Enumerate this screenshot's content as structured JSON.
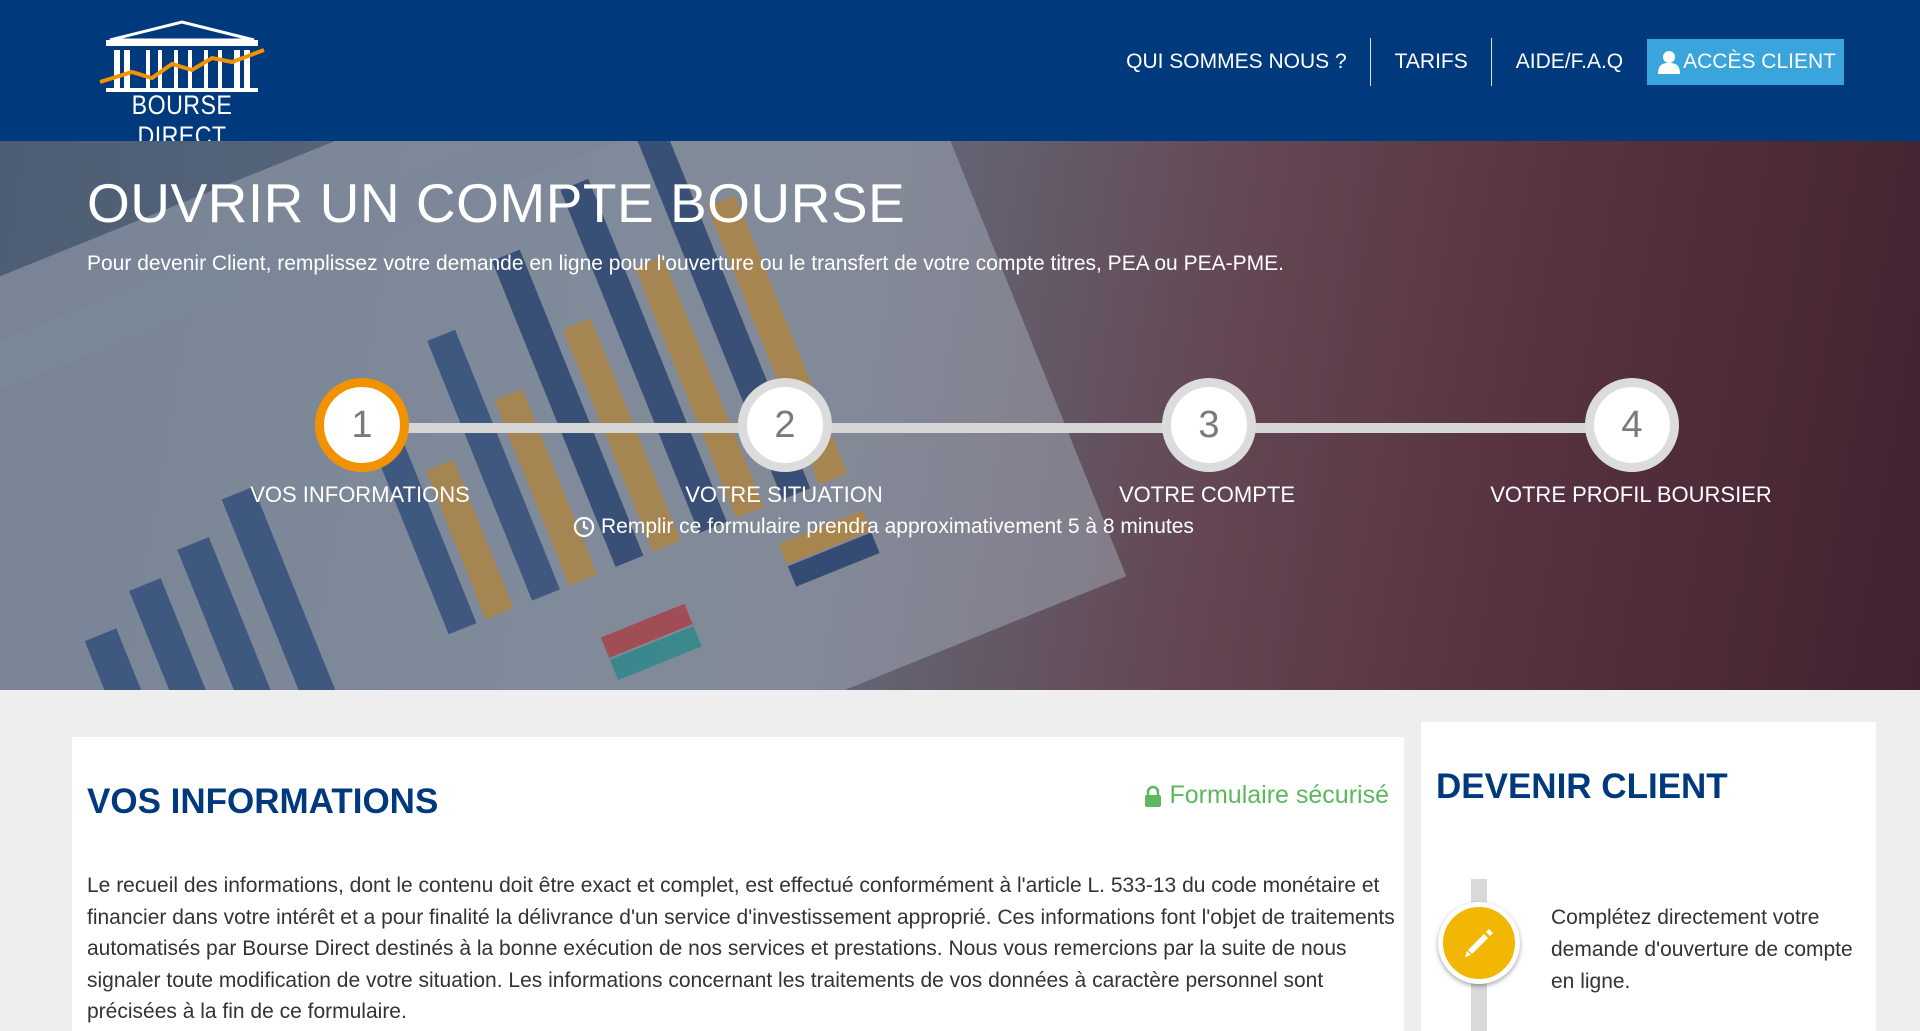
{
  "header": {
    "logo_text": "BOURSE DIRECT",
    "nav": [
      {
        "label": "QUI SOMMES NOUS ?"
      },
      {
        "label": "TARIFS"
      },
      {
        "label": "AIDE/F.A.Q"
      }
    ],
    "client_button": "ACCÈS CLIENT",
    "colors": {
      "header_bg": "#003a7d",
      "client_button_bg": "#3aa4dc"
    }
  },
  "hero": {
    "title": "OUVRIR UN COMPTE BOURSE",
    "subtitle": "Pour devenir Client, remplissez votre demande en ligne pour l'ouverture ou le transfert de votre compte titres, PEA ou PEA-PME.",
    "steps": [
      {
        "number": "1",
        "label": "VOS INFORMATIONS",
        "active": true
      },
      {
        "number": "2",
        "label": "VOTRE SITUATION",
        "active": false
      },
      {
        "number": "3",
        "label": "VOTRE COMPTE",
        "active": false
      },
      {
        "number": "4",
        "label": "VOTRE PROFIL BOURSIER",
        "active": false
      }
    ],
    "duration_text": "Remplir ce formulaire prendra approximativement 5 à 8 minutes",
    "colors": {
      "active_step": "#f39200"
    }
  },
  "form_card": {
    "title": "VOS INFORMATIONS",
    "secure_label": "Formulaire sécurisé",
    "intro": "Le recueil des informations, dont le contenu doit être exact et complet, est effectué conformément à l'article L. 533-13 du code monétaire et financier dans votre intérêt et a pour finalité la délivrance d'un service d'investissement approprié. Ces informations font l'objet de traitements automatisés par Bourse Direct destinés à la bonne exécution de nos services et prestations. Nous vous remercions par la suite de nous signaler toute modification de votre situation. Les informations concernant les traitements de vos données à caractère personnel sont précisées à la fin de ce formulaire.",
    "colors": {
      "title": "#003a7d",
      "secure": "#5cb85c"
    }
  },
  "side_card": {
    "title": "DEVENIR CLIENT",
    "step_text": "Complétez directement votre demande d'ouverture de compte en ligne.",
    "icon": "pencil-icon",
    "colors": {
      "icon_bg": "#f2b705"
    }
  }
}
